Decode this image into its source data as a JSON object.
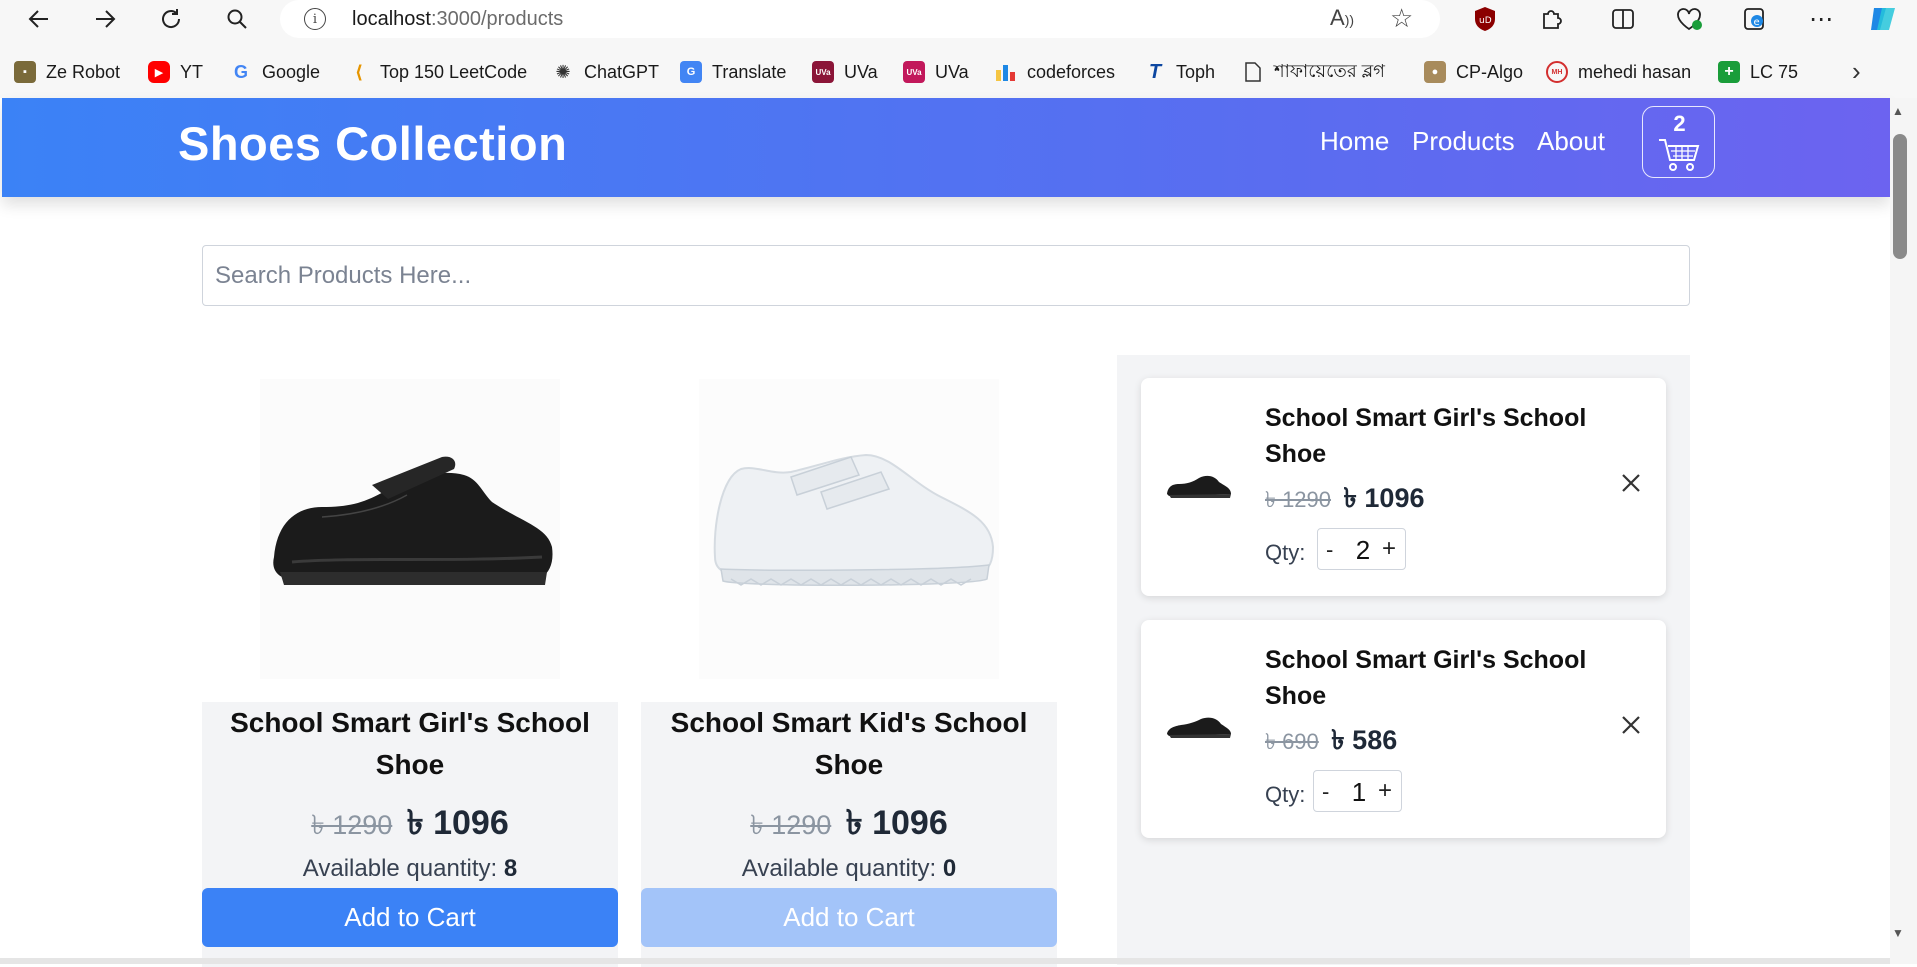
{
  "browser": {
    "url_host": "localhost",
    "url_path": ":3000/products",
    "bookmarks": [
      {
        "label": "Ze Robot",
        "icon": "robot-icon"
      },
      {
        "label": "YT",
        "icon": "youtube-icon"
      },
      {
        "label": "Google",
        "icon": "google-icon"
      },
      {
        "label": "Top 150 LeetCode",
        "icon": "leetcode-icon"
      },
      {
        "label": "ChatGPT",
        "icon": "chatgpt-icon"
      },
      {
        "label": "Translate",
        "icon": "translate-icon"
      },
      {
        "label": "UVa",
        "icon": "uva-hunting-icon"
      },
      {
        "label": "UVa",
        "icon": "uva-icon"
      },
      {
        "label": "codeforces",
        "icon": "codeforces-icon"
      },
      {
        "label": "Toph",
        "icon": "toph-icon"
      },
      {
        "label": "শাফায়েতের ব্লগ",
        "icon": "page-icon"
      },
      {
        "label": "CP-Algo",
        "icon": "cp-algo-icon"
      },
      {
        "label": "mehedi hasan",
        "icon": "mehedi-icon"
      },
      {
        "label": "LC 75",
        "icon": "lc75-icon"
      }
    ]
  },
  "navbar": {
    "brand": "Shoes Collection",
    "links": [
      "Home",
      "Products",
      "About"
    ],
    "cart_count": "2"
  },
  "search": {
    "placeholder": "Search Products Here..."
  },
  "products": [
    {
      "title": "School Smart Girl's School Shoe",
      "old_price": "৳ 1290",
      "new_price": "৳ 1096",
      "avail_label": "Available quantity:",
      "avail_value": "8",
      "button": "Add to Cart",
      "image": "black-mary-jane-shoe"
    },
    {
      "title": "School Smart Kid's School Shoe",
      "old_price": "৳ 1290",
      "new_price": "৳ 1096",
      "avail_label": "Available quantity:",
      "avail_value": "0",
      "button": "Add to Cart",
      "image": "white-velcro-sneaker"
    }
  ],
  "cart": {
    "items": [
      {
        "title": "School Smart Girl's School Shoe",
        "old_price": "৳ 1290",
        "new_price": "৳ 1096",
        "qty_label": "Qty:",
        "qty": "2",
        "minus": "-",
        "plus": "+"
      },
      {
        "title": "School Smart Girl's School Shoe",
        "old_price": "৳ 690",
        "new_price": "৳ 586",
        "qty_label": "Qty:",
        "qty": "1",
        "minus": "-",
        "plus": "+"
      }
    ]
  },
  "colors": {
    "nav_gradient_start": "#3b82f6",
    "nav_gradient_end": "#6c63f0",
    "button_primary": "#3b82f6",
    "button_disabled": "#a3c4f9"
  }
}
